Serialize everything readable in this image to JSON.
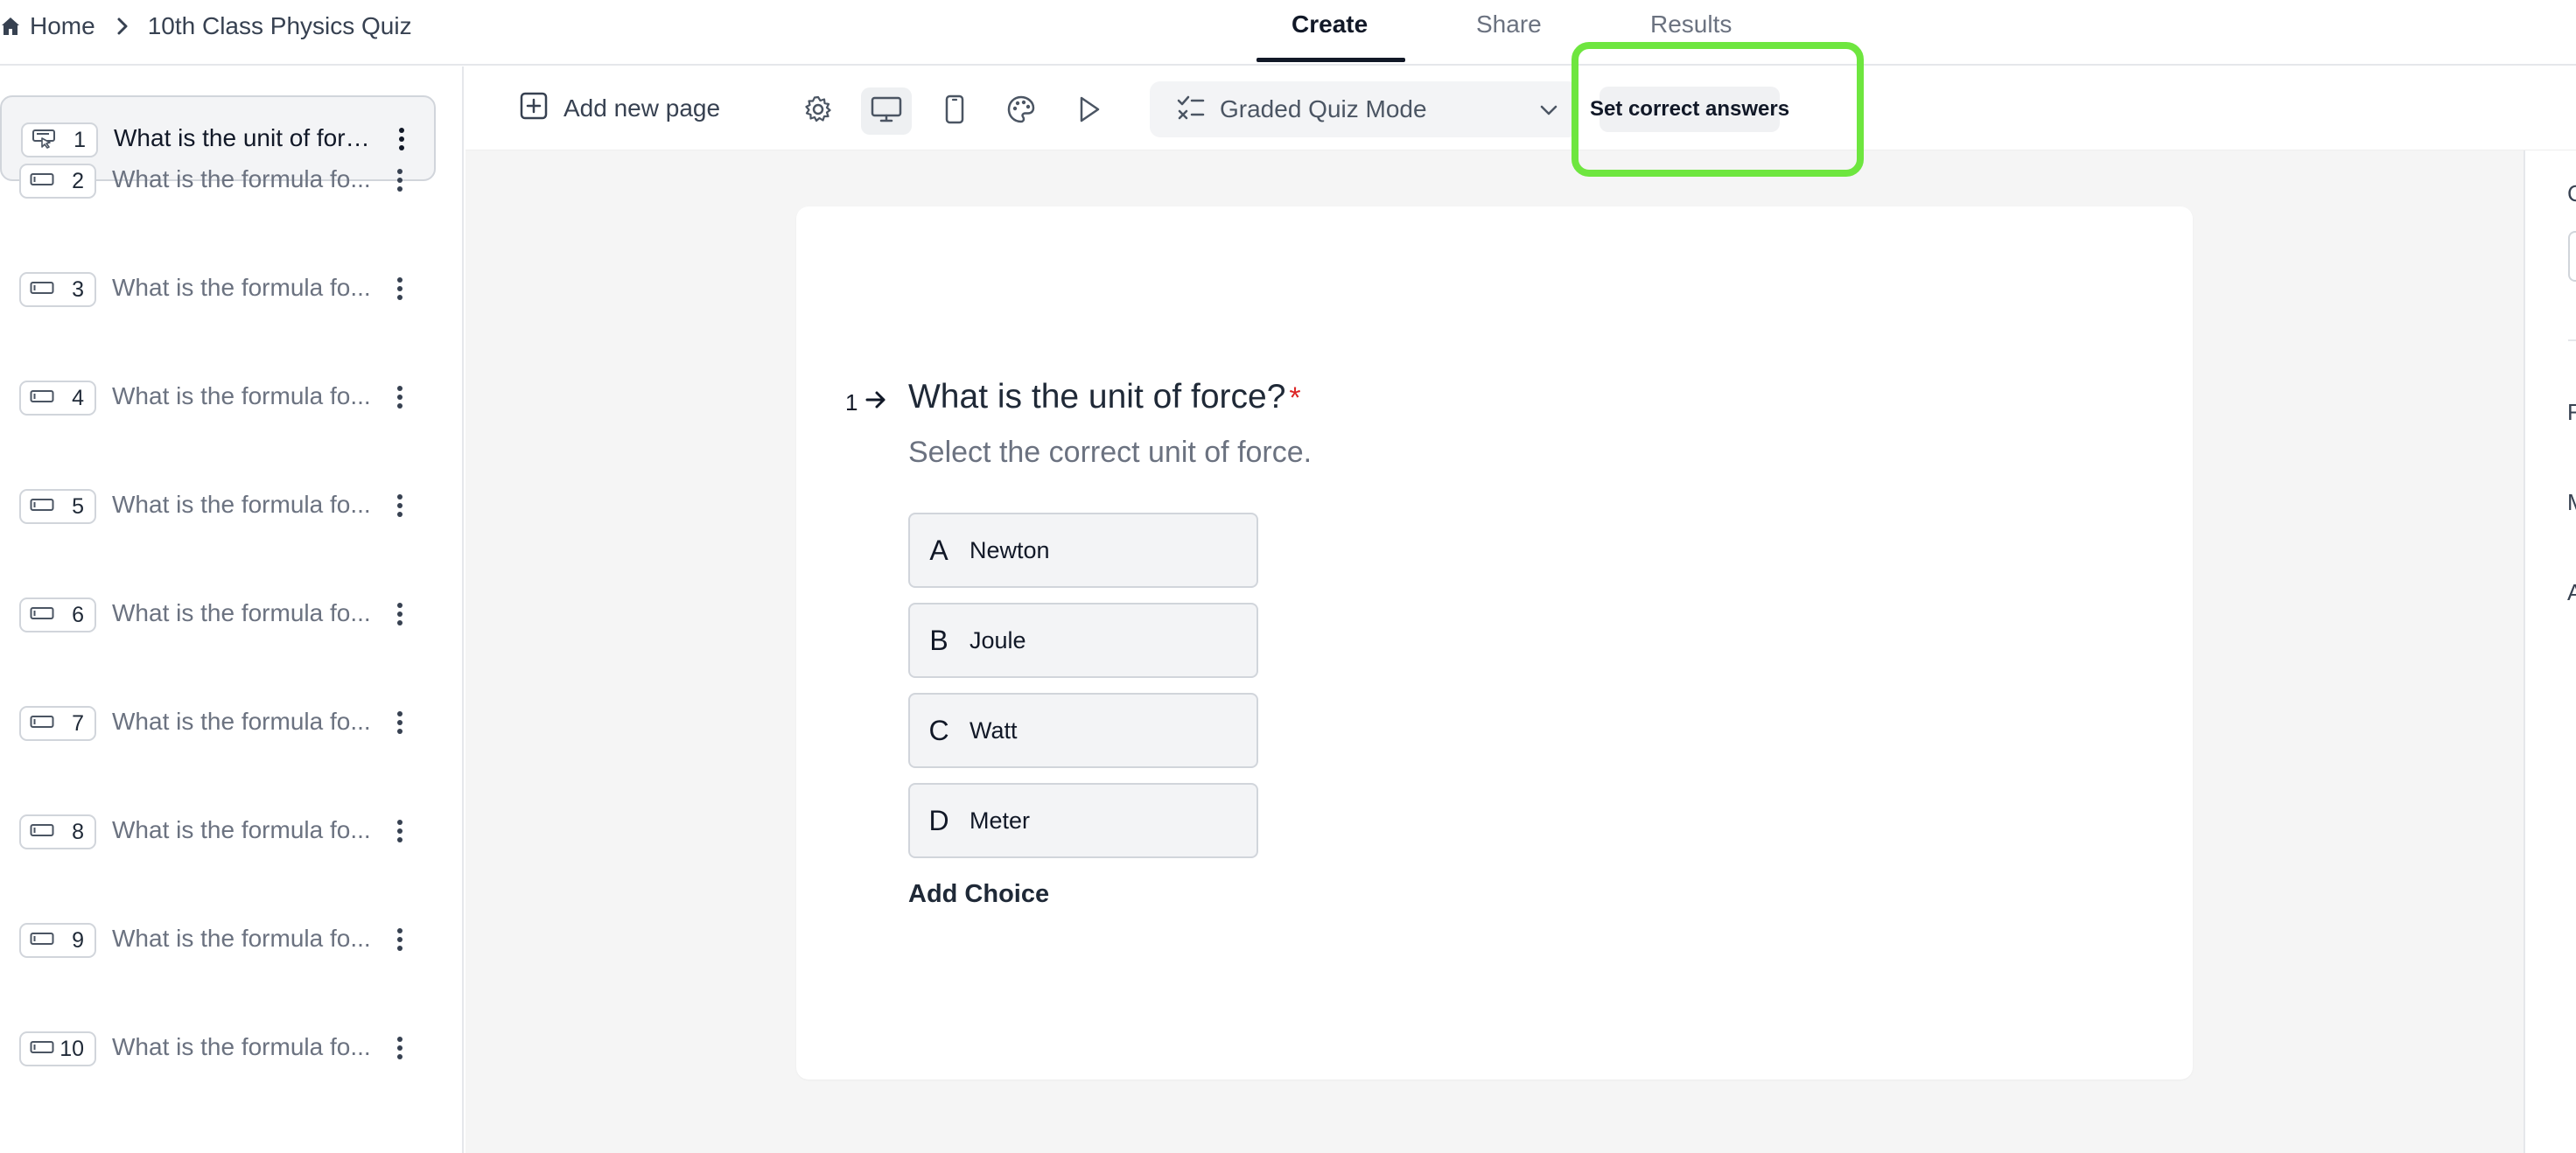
{
  "breadcrumb": {
    "home_label": "Home",
    "quiz_title": "10th Class Physics Quiz"
  },
  "tabs": [
    {
      "label": "Create",
      "active": true
    },
    {
      "label": "Share",
      "active": false
    },
    {
      "label": "Results",
      "active": false
    }
  ],
  "sidebar": {
    "pages": [
      {
        "number": "1",
        "title": "What is the unit of forc...",
        "selected": true
      },
      {
        "number": "2",
        "title": "What is the formula fo...",
        "selected": false
      },
      {
        "number": "3",
        "title": "What is the formula fo...",
        "selected": false
      },
      {
        "number": "4",
        "title": "What is the formula fo...",
        "selected": false
      },
      {
        "number": "5",
        "title": "What is the formula fo...",
        "selected": false
      },
      {
        "number": "6",
        "title": "What is the formula fo...",
        "selected": false
      },
      {
        "number": "7",
        "title": "What is the formula fo...",
        "selected": false
      },
      {
        "number": "8",
        "title": "What is the formula fo...",
        "selected": false
      },
      {
        "number": "9",
        "title": "What is the formula fo...",
        "selected": false
      },
      {
        "number": "10",
        "title": "What is the formula fo...",
        "selected": false
      }
    ]
  },
  "toolbar": {
    "add_page_label": "Add new page",
    "icons": [
      "settings-icon",
      "desktop-icon",
      "mobile-icon",
      "palette-icon",
      "play-icon"
    ],
    "mode_label": "Graded Quiz Mode",
    "set_correct_label": "Set correct answers"
  },
  "question": {
    "number": "1",
    "title": "What is the unit of force?",
    "required_mark": "*",
    "description": "Select the correct unit of force.",
    "choices": [
      {
        "letter": "A",
        "text": "Newton"
      },
      {
        "letter": "B",
        "text": "Joule"
      },
      {
        "letter": "C",
        "text": "Watt"
      },
      {
        "letter": "D",
        "text": "Meter"
      }
    ],
    "add_choice_label": "Add Choice"
  },
  "right_panel": {
    "letters": [
      "C",
      "F",
      "M",
      "A"
    ]
  },
  "colors": {
    "highlight": "#6ee63f",
    "required": "#dc2626",
    "canvas_bg": "#f5f5f5"
  }
}
